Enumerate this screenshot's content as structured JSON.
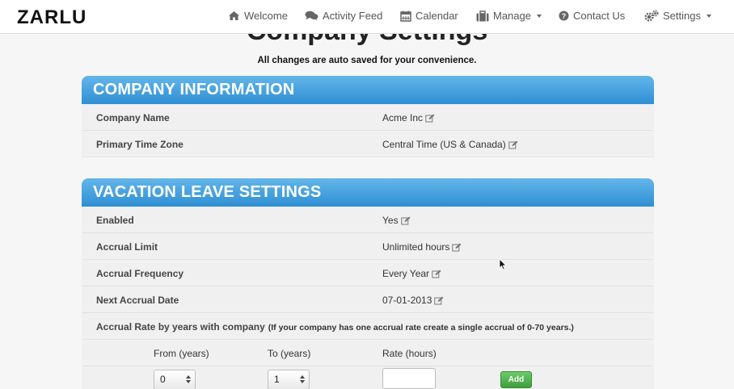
{
  "brand": "ZARLU",
  "nav": {
    "welcome": "Welcome",
    "activity_feed": "Activity Feed",
    "calendar": "Calendar",
    "manage": "Manage",
    "contact_us": "Contact Us",
    "settings": "Settings"
  },
  "page": {
    "title": "Company Settings",
    "subtitle": "All changes are auto saved for your convenience."
  },
  "company_info": {
    "header": "COMPANY INFORMATION",
    "rows": [
      {
        "label": "Company Name",
        "value": "Acme Inc"
      },
      {
        "label": "Primary Time Zone",
        "value": "Central Time (US & Canada)"
      }
    ]
  },
  "vacation": {
    "header": "VACATION LEAVE SETTINGS",
    "rows": [
      {
        "label": "Enabled",
        "value": "Yes"
      },
      {
        "label": "Accrual Limit",
        "value": "Unlimited hours"
      },
      {
        "label": "Accrual Frequency",
        "value": "Every Year"
      },
      {
        "label": "Next Accrual Date",
        "value": "07-01-2013"
      }
    ],
    "accrual_rate_label": "Accrual Rate by years with company",
    "accrual_rate_note": "(If your company has one accrual rate create a single accrual of 0-70 years.)",
    "from_label": "From (years)",
    "to_label": "To (years)",
    "rate_label": "Rate (hours)",
    "from_value": "0",
    "to_value": "1",
    "rate_value": "",
    "add_label": "Add"
  },
  "colors": {
    "header_top": "#63b6ea",
    "header_bottom": "#2f8fd3",
    "add_button": "#4caf4a"
  },
  "icons": [
    "home-icon",
    "comments-icon",
    "calendar-icon",
    "briefcase-icon",
    "question-circle-icon",
    "cogs-icon",
    "edit-icon"
  ]
}
